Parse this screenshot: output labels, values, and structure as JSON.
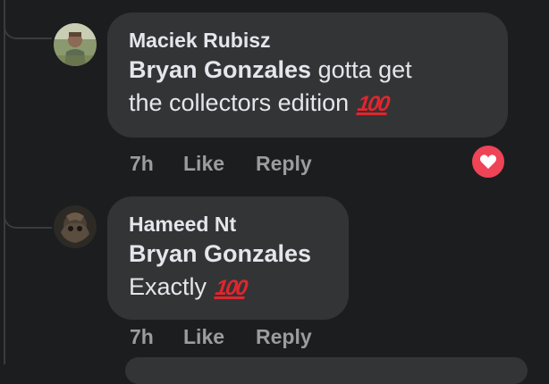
{
  "comments": [
    {
      "author": "Maciek Rubisz",
      "mention": "Bryan Gonzales",
      "text_line1": " gotta get",
      "text_line2": "the collectors edition ",
      "emoji": "100",
      "time": "7h",
      "like_label": "Like",
      "reply_label": "Reply",
      "reaction": "heart-icon",
      "reaction_color": "#ef4356"
    },
    {
      "author": "Hameed Nt",
      "mention": "Bryan Gonzales",
      "text_line2": "Exactly ",
      "emoji": "100",
      "time": "7h",
      "like_label": "Like",
      "reply_label": "Reply"
    }
  ]
}
